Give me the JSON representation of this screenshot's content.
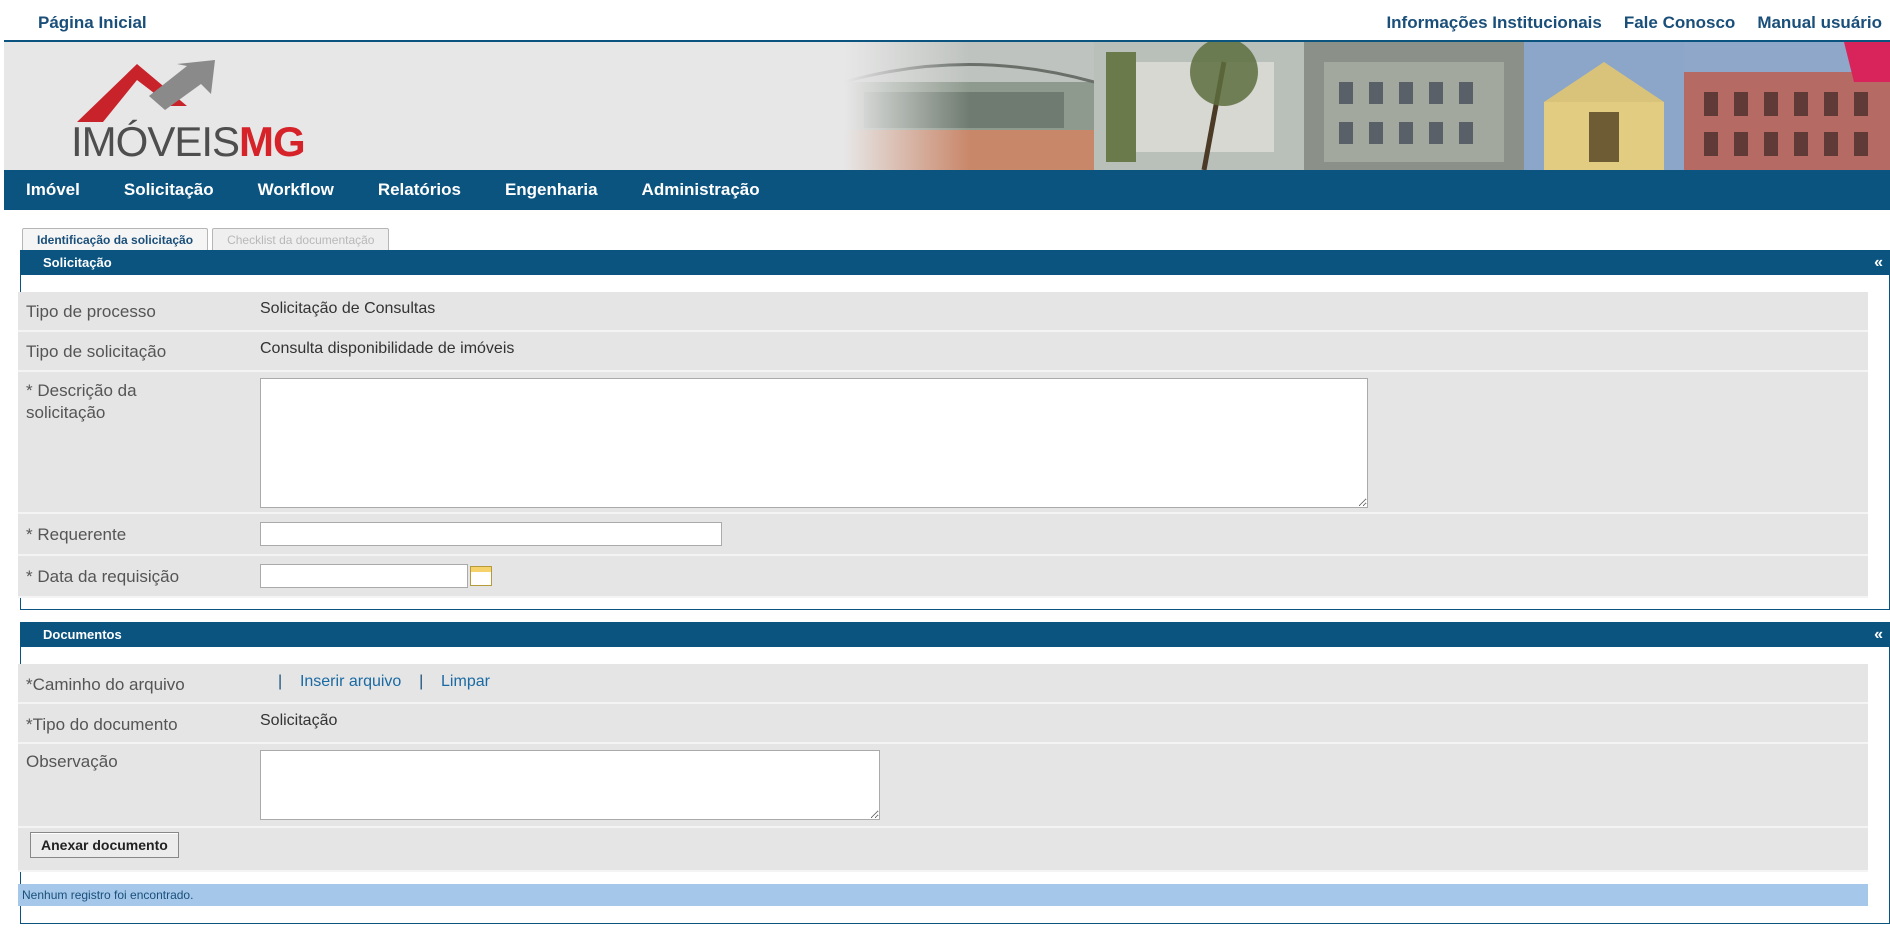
{
  "top_links": {
    "home": "Página Inicial",
    "right": [
      "Informações Institucionais",
      "Fale Conosco",
      "Manual usuário"
    ]
  },
  "logo": {
    "imoveis": "IMÓVEIS",
    "mg": "MG"
  },
  "main_nav": [
    "Imóvel",
    "Solicitação",
    "Workflow",
    "Relatórios",
    "Engenharia",
    "Administração"
  ],
  "tabs": [
    {
      "label": "Identificação da solicitação",
      "active": true
    },
    {
      "label": "Checklist da documentação",
      "active": false
    }
  ],
  "solicitacao": {
    "title": "Solicitação",
    "collapse": "«",
    "tipo_processo_label": "Tipo de processo",
    "tipo_processo_value": "Solicitação de Consultas",
    "tipo_solicitacao_label": "Tipo de solicitação",
    "tipo_solicitacao_value": "Consulta disponibilidade de imóveis",
    "descricao_label_1": "* Descrição da",
    "descricao_label_2": "solicitação",
    "descricao_value": "",
    "requerente_label": "* Requerente",
    "requerente_value": "",
    "data_label": "* Data da requisição",
    "data_value": ""
  },
  "documentos": {
    "title": "Documentos",
    "collapse": "«",
    "caminho_label": "*Caminho do arquivo",
    "sep": "|",
    "inserir": "Inserir arquivo",
    "limpar": "Limpar",
    "tipo_doc_label": "*Tipo do documento",
    "tipo_doc_value": "Solicitação",
    "observacao_label": "Observação",
    "observacao_value": "",
    "anexar_button": "Anexar documento",
    "empty_message": "Nenhum registro foi encontrado."
  },
  "colors": {
    "primary": "#0b5480",
    "link": "#1a4f7a",
    "logo_red": "#d6232a",
    "row_bg": "#e5e5e5",
    "empty_bg": "#a5c8ea"
  }
}
